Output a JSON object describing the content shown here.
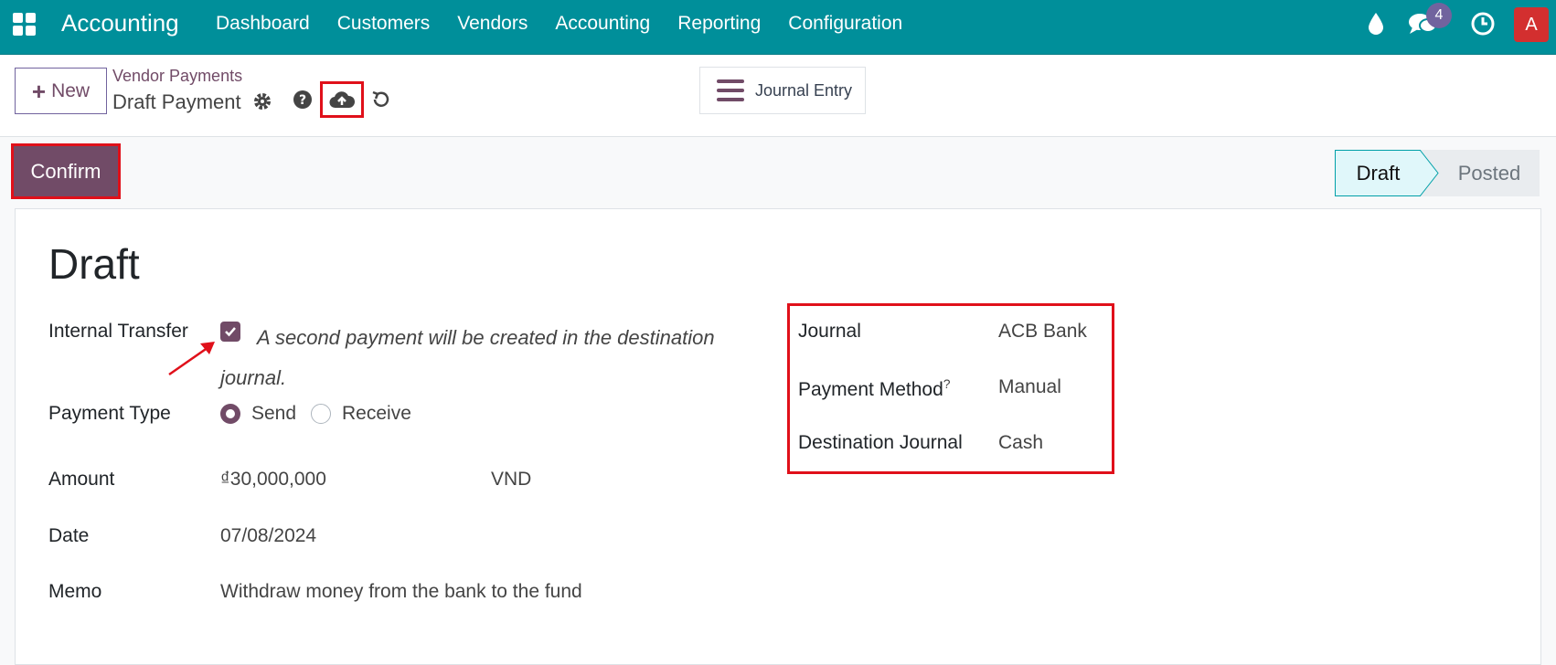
{
  "navbar": {
    "app_name": "Accounting",
    "menu": [
      "Dashboard",
      "Customers",
      "Vendors",
      "Accounting",
      "Reporting",
      "Configuration"
    ],
    "chat_count": "4",
    "avatar_letter": "A",
    "color": "#008f9a"
  },
  "control": {
    "new_label": "New",
    "breadcrumb_parent": "Vendor Payments",
    "record_name": "Draft Payment",
    "smart_button": "Journal Entry"
  },
  "actions": {
    "confirm_label": "Confirm"
  },
  "status": {
    "steps": [
      "Draft",
      "Posted"
    ],
    "current": "Draft"
  },
  "form": {
    "title": "Draft",
    "internal_transfer": {
      "label": "Internal Transfer",
      "checked": true,
      "hint": "A second payment will be created in the destination journal."
    },
    "payment_type": {
      "label": "Payment Type",
      "options": [
        "Send",
        "Receive"
      ],
      "selected": "Send"
    },
    "amount": {
      "label": "Amount",
      "value": "₫30,000,000",
      "currency": "VND"
    },
    "date": {
      "label": "Date",
      "value": "07/08/2024"
    },
    "memo": {
      "label": "Memo",
      "value": "Withdraw money from the bank to the fund"
    },
    "journal": {
      "label": "Journal",
      "value": "ACB Bank"
    },
    "payment_method": {
      "label": "Payment Method",
      "help_mark": "?",
      "value": "Manual"
    },
    "destination_journal": {
      "label": "Destination Journal",
      "value": "Cash"
    }
  },
  "accent": "#714b67"
}
